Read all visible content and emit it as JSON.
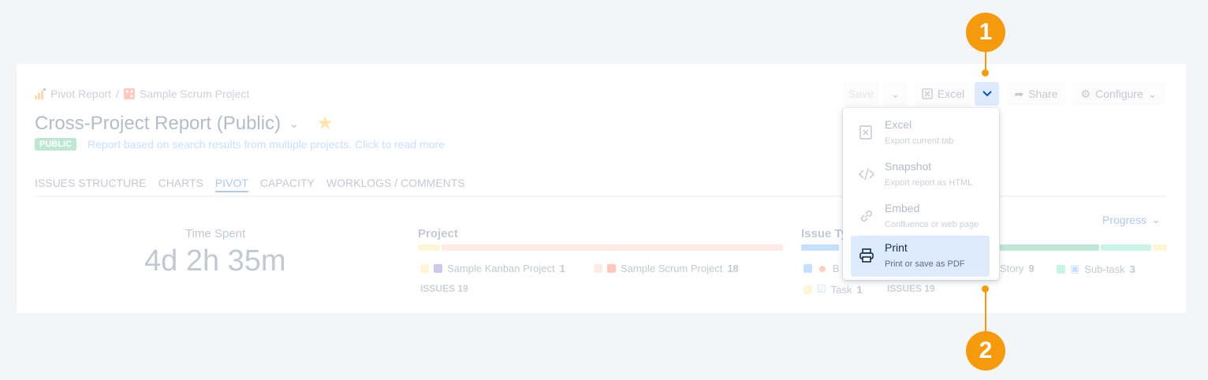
{
  "breadcrumb": {
    "root": "Pivot Report",
    "separator": "/",
    "project": "Sample Scrum Project"
  },
  "report": {
    "title": "Cross-Project Report (Public)",
    "badge": "PUBLIC",
    "description": "Report based on search results from multiple projects. Click to read more"
  },
  "tabs": [
    "ISSUES STRUCTURE",
    "CHARTS",
    "PIVOT",
    "CAPACITY",
    "WORKLOGS / COMMENTS"
  ],
  "toolbar": {
    "save": "Save",
    "excel": "Excel",
    "share": "Share",
    "configure": "Configure"
  },
  "metric": {
    "label": "Time Spent",
    "value": "4d 2h 35m"
  },
  "project_section": {
    "label": "Project",
    "items": [
      {
        "name": "Sample Kanban Project",
        "count": "1"
      },
      {
        "name": "Sample Scrum Project",
        "count": "18"
      }
    ],
    "issues_label": "ISSUES",
    "issues_count": "19"
  },
  "issue_type_section": {
    "label": "Issue Ty",
    "group_by": "Progress",
    "items": [
      {
        "name": "B",
        "count": ""
      },
      {
        "name": "Story",
        "count": "9"
      },
      {
        "name": "Sub-task",
        "count": "3"
      },
      {
        "name": "Task",
        "count": "1"
      }
    ],
    "issues_label": "ISSUES",
    "issues_count": "19"
  },
  "export_menu": [
    {
      "title": "Excel",
      "subtitle": "Export current tab"
    },
    {
      "title": "Snapshot",
      "subtitle": "Export report as HTML"
    },
    {
      "title": "Embed",
      "subtitle": "Confluence or web page"
    },
    {
      "title": "Print",
      "subtitle": "Print or save as PDF"
    }
  ],
  "callouts": [
    "1",
    "2"
  ],
  "colors": {
    "accent": "#0052cc",
    "callout": "#f59a0c",
    "selected": "#deebff"
  }
}
